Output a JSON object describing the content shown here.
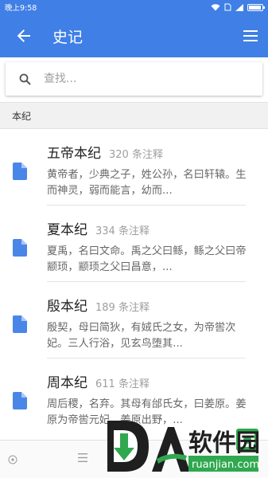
{
  "status_bar": {
    "time": "晚上9:58"
  },
  "app_bar": {
    "title": "史记",
    "back_icon": "arrow-back-icon",
    "menu_icon": "hamburger-menu-icon"
  },
  "search": {
    "placeholder": "查找...",
    "value": ""
  },
  "section": {
    "title": "本纪"
  },
  "list": {
    "items": [
      {
        "title": "五帝本纪",
        "count": "320 条注释",
        "excerpt": "黄帝者，少典之子，姓公孙，名曰轩辕。生而神灵，弱而能言，幼而..."
      },
      {
        "title": "夏本纪",
        "count": "334 条注释",
        "excerpt": "夏禹，名曰文命。禹之父曰鲧，鲧之父曰帝颛顼，颛顼之父曰昌意，..."
      },
      {
        "title": "殷本纪",
        "count": "189 条注释",
        "excerpt": "殷契，母曰简狄，有娀氏之女，为帝喾次妃。三人行浴，见玄鸟堕其..."
      },
      {
        "title": "周本纪",
        "count": "611 条注释",
        "excerpt": "周后稷，名弃。其母有邰氏女，曰姜原。姜原为帝喾元妃。姜原出野，..."
      }
    ]
  },
  "colors": {
    "primary": "#3f7fe6",
    "doc_icon": "#4a86e8"
  },
  "watermark": {
    "text": "软件园",
    "url": "ruanjian.com"
  }
}
